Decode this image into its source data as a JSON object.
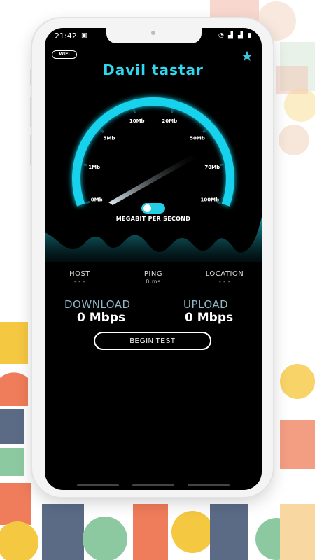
{
  "status_bar": {
    "time": "21:42"
  },
  "header": {
    "network_badge": "WIFI",
    "app_title": "Davil tastar"
  },
  "gauge": {
    "labels": [
      "0Mb",
      "1Mb",
      "5Mb",
      "10Mb",
      "20Mb",
      "50Mb",
      "70Mb",
      "100Mb"
    ],
    "unit_label": "MEGABIT PER SECOND",
    "current_value": 0
  },
  "stats": {
    "host": {
      "label": "HOST",
      "value": "- - -"
    },
    "ping": {
      "label": "PING",
      "value": "0 ms"
    },
    "location": {
      "label": "LOCATION",
      "value": "- - -"
    }
  },
  "download": {
    "label": "DOWNLOAD",
    "value": "0",
    "unit": "Mbps"
  },
  "upload": {
    "label": "UPLOAD",
    "value": "0",
    "unit": "Mbps"
  },
  "action": {
    "begin_label": "BEGIN TEST"
  },
  "colors": {
    "accent": "#2ed8f0",
    "background": "#000000"
  }
}
